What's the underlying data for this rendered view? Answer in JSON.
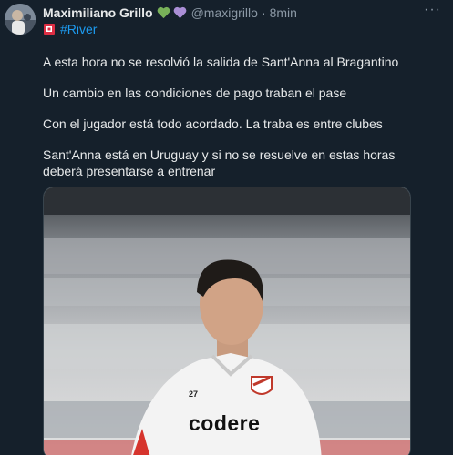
{
  "tweet": {
    "author_name": "Maximiliano Grillo",
    "handle": "@maxigrillo",
    "separator": "·",
    "time": "8min",
    "hashtag": "#River",
    "paragraphs": [
      "A esta hora no se resolvió la salida de Sant'Anna al Bragantino",
      "Un cambio en las condiciones de pago traban el pase",
      "Con el jugador está todo acordado. La traba es entre clubes",
      "Sant'Anna está en Uruguay y si no se resuelve en estas horas deberá presentarse a entrenar"
    ],
    "more_label": "···"
  },
  "photo": {
    "shirt_sponsor": "codere",
    "shirt_number": "27"
  },
  "colors": {
    "background": "#15202b",
    "text": "#e7e9ea",
    "muted": "#8b98a5",
    "link": "#1d9bf0",
    "heart_green": "#78b159",
    "heart_purple": "#aa8ed6"
  },
  "icons": [
    "green-heart-icon",
    "purple-heart-icon",
    "red-flag-icon",
    "more-options-icon"
  ]
}
